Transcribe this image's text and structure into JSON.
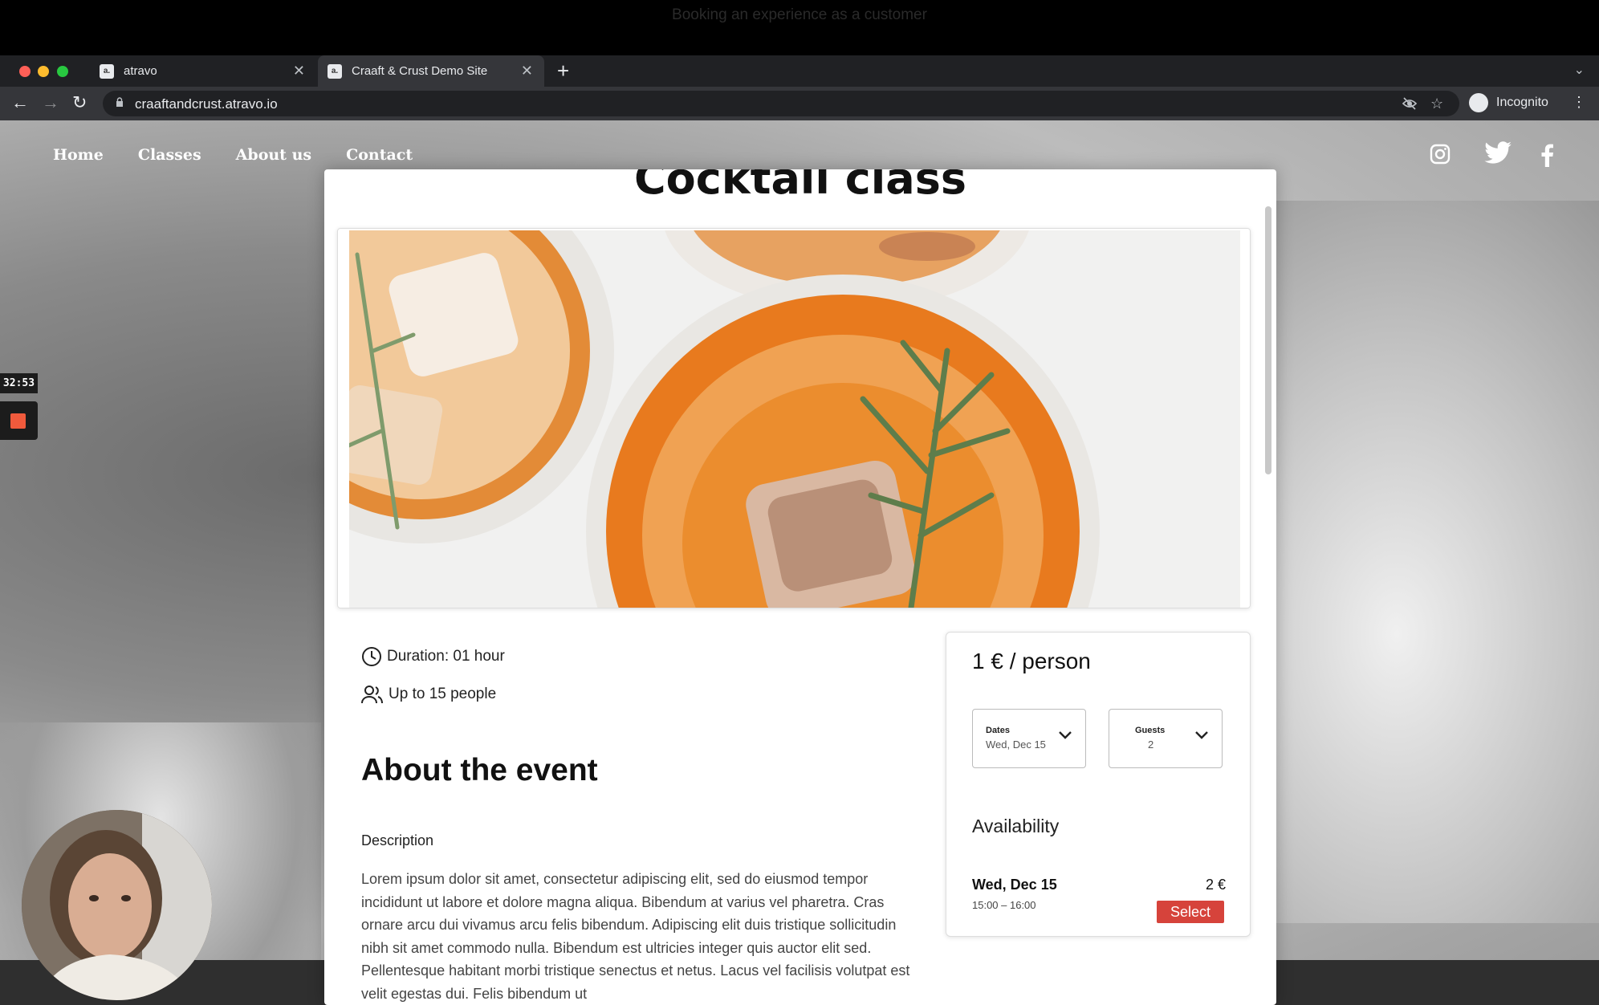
{
  "recording": {
    "caption": "Booking an experience as a customer",
    "timer": "32:53"
  },
  "browser": {
    "tabs": [
      {
        "title": "atravo",
        "favicon": "a."
      },
      {
        "title": "Craaft & Crust Demo Site",
        "favicon": "a."
      }
    ],
    "url": "craaftandcrust.atravo.io",
    "profile": "Incognito"
  },
  "site": {
    "nav": [
      "Home",
      "Classes",
      "About us",
      "Contact"
    ],
    "social_icons": [
      "instagram-icon",
      "twitter-icon",
      "facebook-icon"
    ],
    "title": "Cocktail class",
    "duration": "Duration: 01 hour",
    "capacity": "Up to 15 people",
    "about_heading": "About the event",
    "description_label": "Description",
    "description": "Lorem ipsum dolor sit amet, consectetur adipiscing elit, sed do eiusmod tempor incididunt ut labore et dolore magna aliqua. Bibendum at varius vel pharetra. Cras ornare arcu dui vivamus arcu felis bibendum. Adipiscing elit duis tristique sollicitudin nibh sit amet commodo nulla. Bibendum est ultricies integer quis auctor elit sed. Pellentesque habitant morbi tristique senectus et netus. Lacus vel facilisis volutpat est velit egestas dui. Felis bibendum ut",
    "booking": {
      "price": "1 € / person",
      "dates_label": "Dates",
      "dates_value": "Wed, Dec 15",
      "guests_label": "Guests",
      "guests_value": "2",
      "availability_heading": "Availability",
      "slot": {
        "date": "Wed, Dec 15",
        "time": "15:00 – 16:00",
        "price": "2 €",
        "action": "Select"
      }
    }
  },
  "colors": {
    "accent": "#d6433b",
    "chrome_dark": "#202124",
    "chrome_toolbar": "#35363a",
    "recording_red": "#f05a3c"
  }
}
